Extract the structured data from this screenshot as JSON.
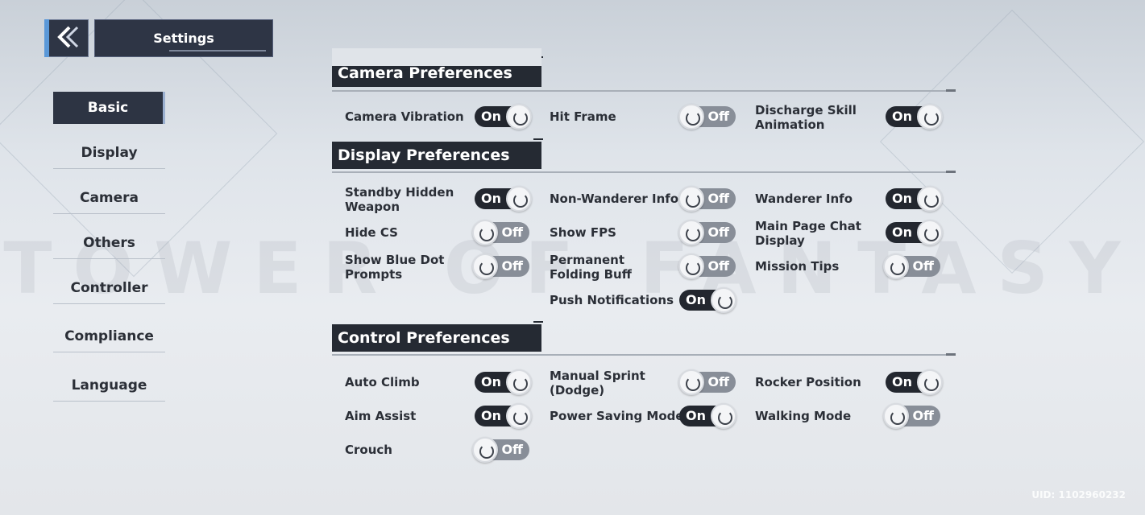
{
  "header": {
    "title": "Settings"
  },
  "sidebar": {
    "items": [
      {
        "label": "Basic",
        "active": true
      },
      {
        "label": "Display"
      },
      {
        "label": "Camera"
      },
      {
        "label": "Others"
      },
      {
        "label": "Controller"
      },
      {
        "label": "Compliance"
      },
      {
        "label": "Language"
      }
    ]
  },
  "watermark": "TOWER OF FANTASY",
  "sections": {
    "camera": {
      "title": "Camera Preferences",
      "settings": {
        "camera_vibration": {
          "label": "Camera Vibration",
          "state": "On"
        },
        "hit_frame": {
          "label": "Hit Frame",
          "state": "Off"
        },
        "discharge_skill_animation": {
          "label": "Discharge Skill Animation",
          "state": "On"
        }
      }
    },
    "display": {
      "title": "Display Preferences",
      "settings": {
        "standby_hidden_weapon": {
          "label": "Standby Hidden Weapon",
          "state": "On"
        },
        "non_wanderer_info": {
          "label": "Non-Wanderer Info",
          "state": "Off"
        },
        "wanderer_info": {
          "label": "Wanderer Info",
          "state": "On"
        },
        "hide_cs": {
          "label": "Hide CS",
          "state": "Off"
        },
        "show_fps": {
          "label": "Show FPS",
          "state": "Off"
        },
        "main_page_chat_display": {
          "label": "Main Page Chat Display",
          "state": "On"
        },
        "show_blue_dot_prompts": {
          "label": "Show Blue Dot Prompts",
          "state": "Off"
        },
        "permanent_folding_buff": {
          "label": "Permanent Folding Buff",
          "state": "Off"
        },
        "mission_tips": {
          "label": "Mission Tips",
          "state": "Off"
        },
        "push_notifications": {
          "label": "Push Notifications",
          "state": "On"
        }
      }
    },
    "control": {
      "title": "Control Preferences",
      "settings": {
        "auto_climb": {
          "label": "Auto Climb",
          "state": "On"
        },
        "manual_sprint": {
          "label": "Manual Sprint (Dodge)",
          "state": "Off"
        },
        "rocker_position": {
          "label": "Rocker Position",
          "state": "On"
        },
        "aim_assist": {
          "label": "Aim Assist",
          "state": "On"
        },
        "power_saving_mode": {
          "label": "Power Saving Mode",
          "state": "On"
        },
        "walking_mode": {
          "label": "Walking Mode",
          "state": "Off"
        },
        "crouch": {
          "label": "Crouch",
          "state": "Off"
        }
      }
    }
  },
  "footer": {
    "uid": "UID: 1102960232"
  },
  "colors": {
    "panel_dark": "#252a33",
    "toggle_on": "#23272f",
    "toggle_off": "#888e98",
    "accent": "#5a98d8"
  }
}
